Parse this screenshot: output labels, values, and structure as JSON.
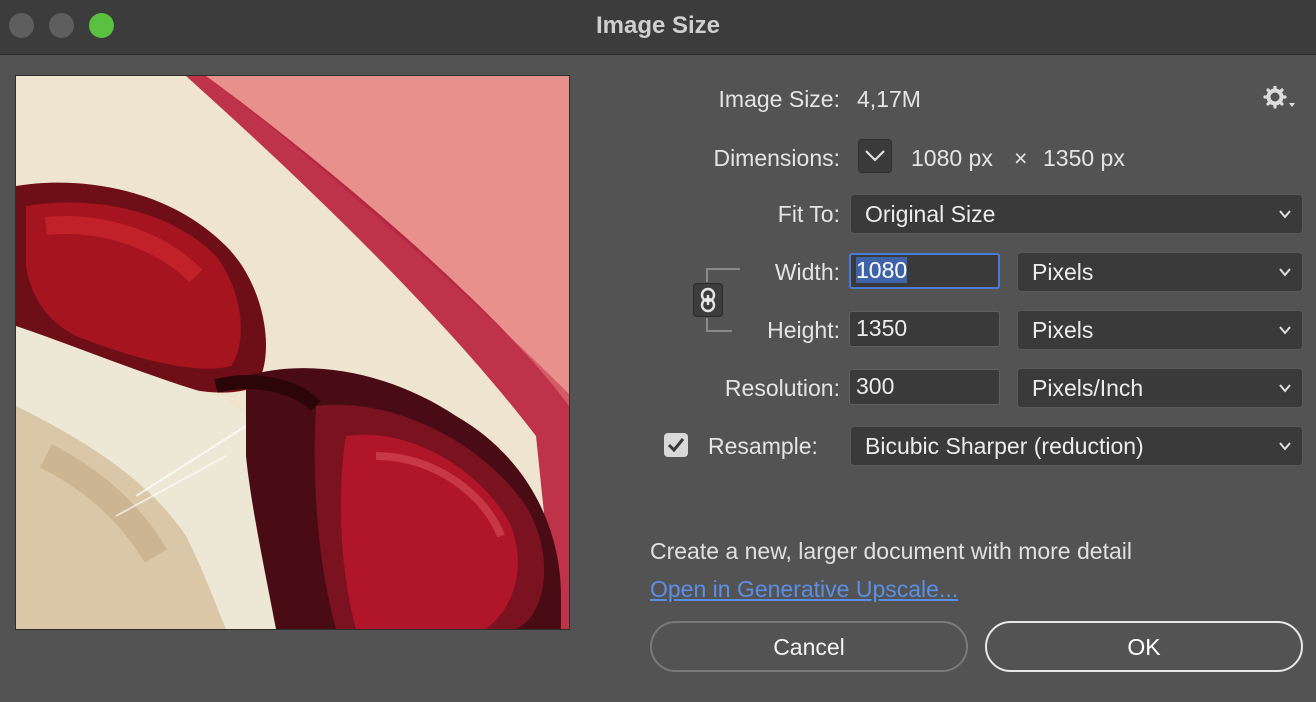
{
  "window": {
    "title": "Image Size"
  },
  "image_size": {
    "label": "Image Size:",
    "value": "4,17M"
  },
  "dimensions": {
    "label": "Dimensions:",
    "width": "1080 px",
    "times": "×",
    "height": "1350 px"
  },
  "fit_to": {
    "label": "Fit To:",
    "value": "Original Size"
  },
  "width": {
    "label": "Width:",
    "value": "1080",
    "unit": "Pixels"
  },
  "height": {
    "label": "Height:",
    "value": "1350",
    "unit": "Pixels"
  },
  "resolution": {
    "label": "Resolution:",
    "value": "300",
    "unit": "Pixels/Inch"
  },
  "resample": {
    "label": "Resample:",
    "checked": true,
    "value": "Bicubic Sharper (reduction)"
  },
  "upscale": {
    "info": "Create a new, larger document with more detail",
    "link": "Open in Generative Upscale..."
  },
  "buttons": {
    "cancel": "Cancel",
    "ok": "OK"
  },
  "icons": {
    "settings": "gear-icon",
    "link": "chain-link-icon",
    "chevron": "chevron-down-icon",
    "check": "checkmark-icon"
  },
  "colors": {
    "accent": "#4b7bd4",
    "link": "#5b8fe6",
    "zoom": "#59c13f"
  }
}
